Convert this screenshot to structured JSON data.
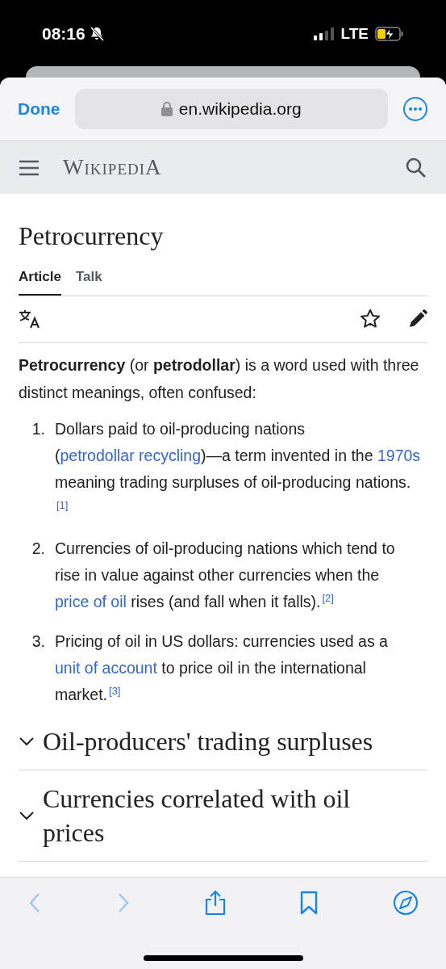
{
  "status_bar": {
    "time": "08:16",
    "silent": true,
    "network": "LTE",
    "charging": true
  },
  "browser": {
    "done": "Done",
    "url": "en.wikipedia.org"
  },
  "site_header": {
    "wordmark": "WikipediA"
  },
  "article": {
    "title": "Petrocurrency",
    "tabs": [
      {
        "label": "Article",
        "selected": true
      },
      {
        "label": "Talk",
        "selected": false
      }
    ],
    "intro": "**Petrocurrency** (or **petrodollar**) is a word used with three distinct meanings, often confused:",
    "list": [
      {
        "number": "1.",
        "segments": [
          {
            "kind": "text",
            "text": "Dollars paid to oil-producing nations ("
          },
          {
            "kind": "link",
            "text": "petrodollar recycling"
          },
          {
            "kind": "text",
            "text": ")—a term invented in the "
          },
          {
            "kind": "link",
            "text": "1970s"
          },
          {
            "kind": "text",
            "text": " meaning trading surpluses of oil-producing nations."
          },
          {
            "kind": "ref",
            "text": "[1]"
          }
        ]
      },
      {
        "number": "2.",
        "segments": [
          {
            "kind": "text",
            "text": "Currencies of oil-producing nations which tend to rise in value against other currencies when the "
          },
          {
            "kind": "link",
            "text": "price of oil"
          },
          {
            "kind": "text",
            "text": " rises (and fall when it falls)."
          },
          {
            "kind": "ref",
            "text": "[2]"
          }
        ]
      },
      {
        "number": "3.",
        "segments": [
          {
            "kind": "text",
            "text": "Pricing of oil in US dollars: currencies used as a "
          },
          {
            "kind": "link",
            "text": "unit of account"
          },
          {
            "kind": "text",
            "text": " to price oil in the international market."
          },
          {
            "kind": "ref",
            "text": "[3]"
          }
        ]
      }
    ],
    "sections": [
      {
        "title": "Oil-producers' trading surpluses",
        "expanded": false
      },
      {
        "title": "Currencies correlated with oil prices",
        "expanded": false
      }
    ]
  },
  "toolbar": {
    "back_disabled": true,
    "forward_disabled": true
  }
}
